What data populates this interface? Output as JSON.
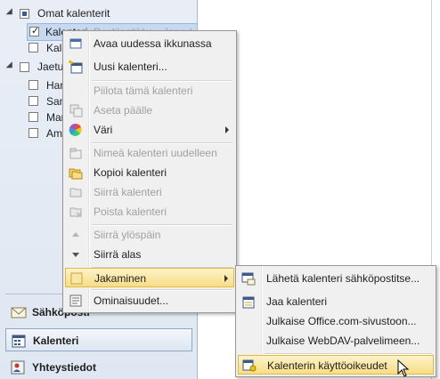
{
  "nav": {
    "group_own": "Omat kalenterit",
    "group_shared": "Jaetut",
    "own_items": [
      {
        "label": "Kalenteri",
        "checked": true,
        "extra": "Postilaatikko - Jane I"
      },
      {
        "label": "Kale",
        "checked": false
      }
    ],
    "shared_items": [
      {
        "label": "Har"
      },
      {
        "label": "San"
      },
      {
        "label": "Mar"
      },
      {
        "label": "Ami"
      }
    ],
    "buttons": {
      "mail": "Sähköposti",
      "calendar": "Kalenteri",
      "contacts": "Yhteystiedot"
    }
  },
  "context_menu": {
    "items": [
      {
        "label": "Avaa uudessa ikkunassa",
        "icon": "open-window-icon",
        "enabled": true
      },
      {
        "label": "Uusi kalenteri...",
        "icon": "new-calendar-icon",
        "enabled": true
      },
      {
        "label": "Piilota tämä kalenteri",
        "icon": "",
        "enabled": false
      },
      {
        "label": "Aseta päälle",
        "icon": "overlay-icon",
        "enabled": false
      },
      {
        "label": "Väri",
        "icon": "color-icon",
        "enabled": true,
        "submenu": true
      },
      {
        "label": "Nimeä kalenteri uudelleen",
        "icon": "rename-icon",
        "enabled": false
      },
      {
        "label": "Kopioi kalenteri",
        "icon": "copy-folder-icon",
        "enabled": true
      },
      {
        "label": "Siirrä kalenteri",
        "icon": "move-folder-icon",
        "enabled": false
      },
      {
        "label": "Poista kalenteri",
        "icon": "delete-folder-icon",
        "enabled": false
      },
      {
        "label": "Siirrä ylöspäin",
        "icon": "move-up-icon",
        "enabled": false
      },
      {
        "label": "Siirrä alas",
        "icon": "move-down-icon",
        "enabled": true
      },
      {
        "label": "Jakaminen",
        "icon": "sharing-icon",
        "enabled": true,
        "submenu": true,
        "highlighted": true
      },
      {
        "label": "Ominaisuudet...",
        "icon": "properties-icon",
        "enabled": true
      }
    ]
  },
  "sharing_menu": {
    "items": [
      {
        "label": "Lähetä kalenteri sähköpostitse...",
        "icon": "email-calendar-icon"
      },
      {
        "label": "Jaa kalenteri",
        "icon": "share-calendar-icon"
      },
      {
        "label": "Julkaise Office.com-sivustoon...",
        "icon": ""
      },
      {
        "label": "Julkaise WebDAV-palvelimeen...",
        "icon": ""
      },
      {
        "label": "Kalenterin käyttöoikeudet",
        "icon": "calendar-permissions-icon",
        "highlighted": true
      }
    ]
  },
  "colors": {
    "menu_bg": "#f0f0f0",
    "highlight_top": "#fcf3c9",
    "highlight_bottom": "#f8dd86",
    "disabled_text": "#a0a0a0",
    "nav_selected": "#c8d9ef"
  }
}
